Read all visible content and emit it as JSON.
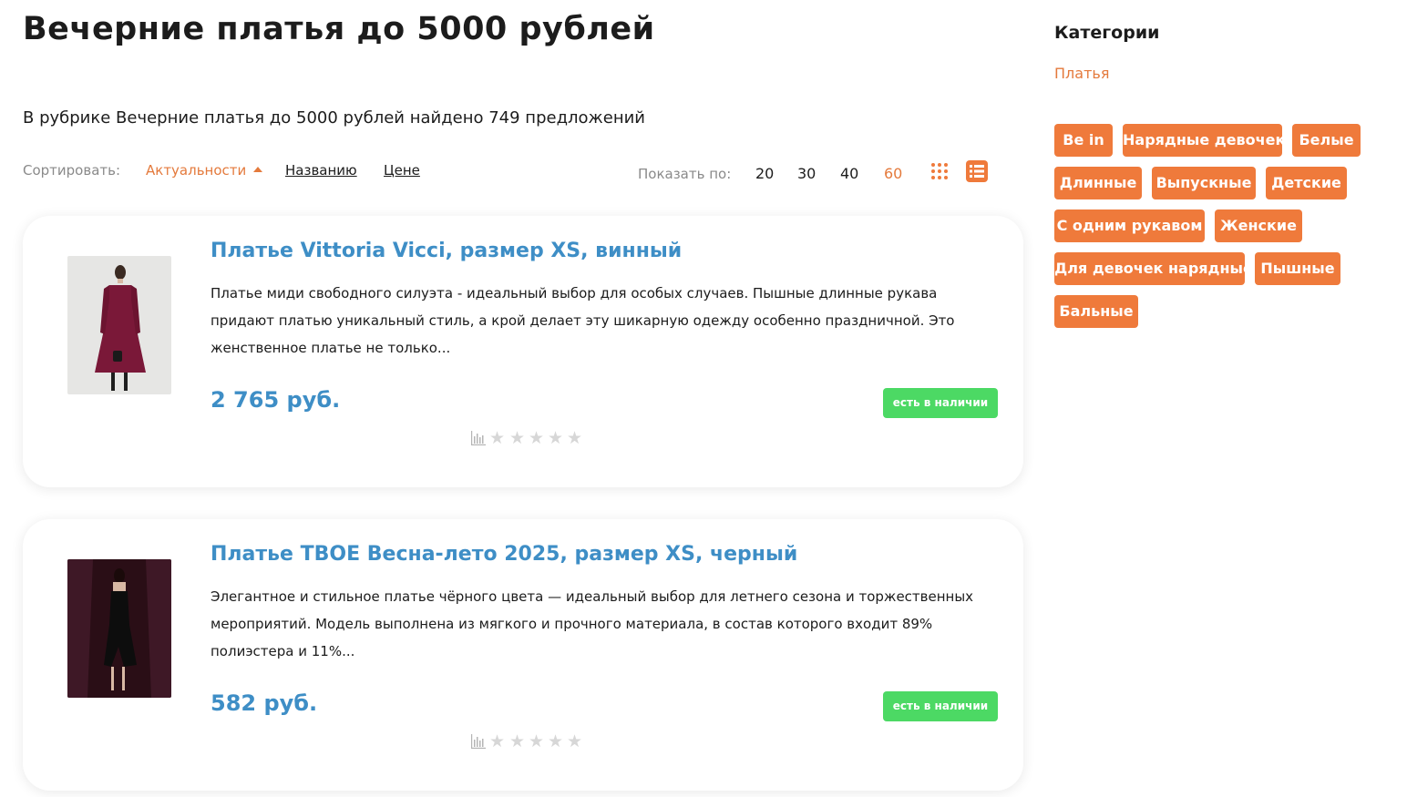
{
  "page": {
    "title": "Вечерние платья до 5000 рублей",
    "found_text": "В рубрике Вечерние платья до 5000 рублей найдено 749 предложений"
  },
  "sort": {
    "label": "Сортировать:",
    "options": [
      "Актуальности",
      "Названию",
      "Цене"
    ],
    "active": "Актуальности"
  },
  "per_page": {
    "label": "Показать по:",
    "options": [
      "20",
      "30",
      "40",
      "60"
    ],
    "active": "60"
  },
  "view_modes": {
    "grid_icon": "grid-dots-icon",
    "list_icon": "list-icon",
    "active": "list"
  },
  "products": [
    {
      "title": "Платье Vittoria Vicci, размер XS, винный",
      "description": "Платье миди свободного силуэта - идеальный выбор для особых случаев. Пышные длинные рукава придают платью уникальный стиль, а крой делает эту шикарную одежду особенно праздничной. Это женственное платье не только...",
      "price": "2 765 руб.",
      "availability": "есть в наличии",
      "rating": 0,
      "image_color": "#7a1838"
    },
    {
      "title": "Платье ТВОЕ Весна-лето 2025, размер XS, черный",
      "description": "Элегантное и стильное платье чёрного цвета — идеальный выбор для летнего сезона и торжественных мероприятий. Модель выполнена из мягкого и прочного материала, в состав которого входит 89% полиэстера и 11%...",
      "price": "582 руб.",
      "availability": "есть в наличии",
      "rating": 0,
      "image_color": "#3a1420"
    }
  ],
  "sidebar": {
    "title": "Категории",
    "category_link": "Платья",
    "tags": [
      "Be in",
      "Нарядные девочек",
      "Белые",
      "Длинные",
      "Выпускные",
      "Детские",
      "С одним рукавом",
      "Женские",
      "Для девочек нарядные",
      "Пышные",
      "Бальные"
    ]
  },
  "colors": {
    "accent": "#ef7a3b",
    "link": "#3e8ec6",
    "in_stock": "#4cd964",
    "star_empty": "#d7d7d7"
  }
}
